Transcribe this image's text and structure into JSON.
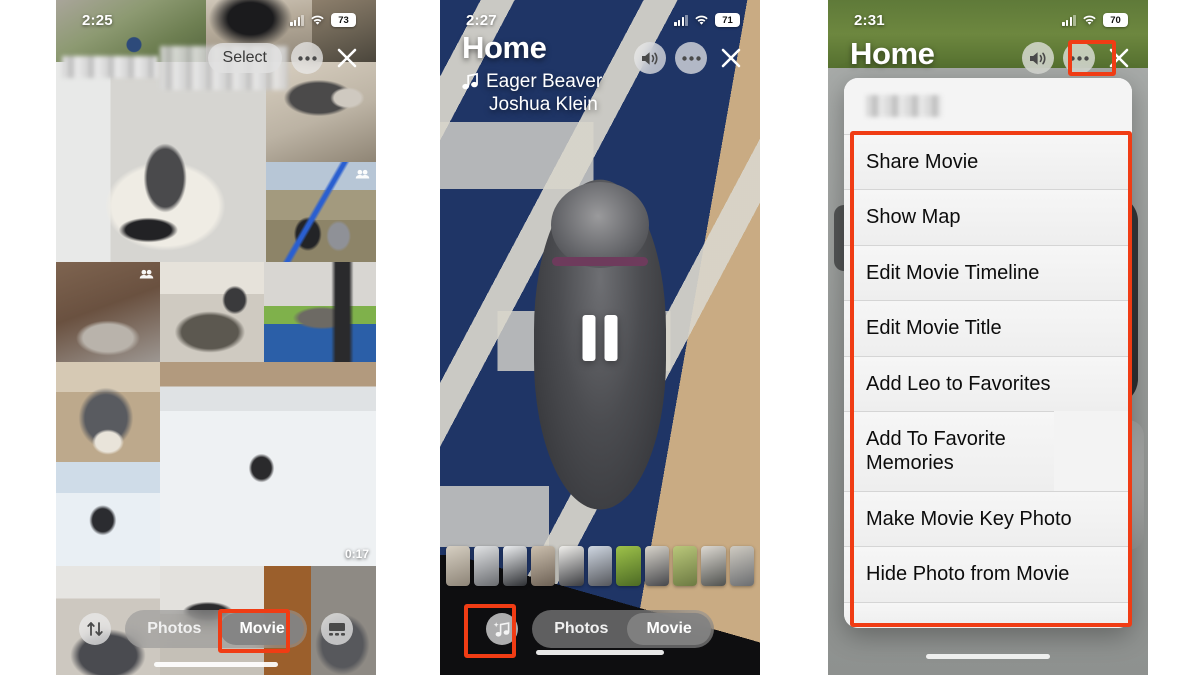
{
  "panels": {
    "left": {
      "status": {
        "time": "2:25",
        "battery": "73",
        "wifi_icon": "wifi-icon",
        "cellular_icon": "cellular-signal-icon"
      },
      "toolbar": {
        "select_label": "Select",
        "more_icon": "ellipsis-icon",
        "close_icon": "close-x-icon"
      },
      "grid": {
        "video_duration": "0:17",
        "people_badge_icon": "people-badge-icon",
        "redacted_label": ""
      },
      "bottom": {
        "sort_icon": "sort-arrows-icon",
        "segment": {
          "options": [
            "Photos",
            "Movie"
          ],
          "selected": "Movie"
        },
        "layout_icon": "grid-layout-icon"
      }
    },
    "middle": {
      "status": {
        "time": "2:27",
        "battery": "71",
        "wifi_icon": "wifi-icon",
        "cellular_icon": "cellular-signal-icon"
      },
      "title": "Home",
      "song": {
        "note_icon": "music-note-icon",
        "track": "Eager Beaver",
        "artist": "Joshua Klein"
      },
      "actions": {
        "volume_icon": "speaker-volume-icon",
        "more_icon": "ellipsis-icon",
        "close_icon": "close-x-icon"
      },
      "playback": {
        "state_icon": "pause-icon"
      },
      "bottom": {
        "music_icon": "music-note-sparkle-icon",
        "segment": {
          "options": [
            "Photos",
            "Movie"
          ],
          "selected": "Movie"
        }
      }
    },
    "right": {
      "status": {
        "time": "2:31",
        "battery": "70",
        "wifi_icon": "wifi-icon",
        "cellular_icon": "cellular-signal-icon"
      },
      "title": "Home",
      "actions": {
        "volume_icon": "speaker-volume-icon",
        "more_icon": "ellipsis-icon",
        "close_icon": "close-x-icon"
      },
      "menu": {
        "header_redacted": "",
        "items": [
          "Share Movie",
          "Show Map",
          "Edit Movie Timeline",
          "Edit Movie Title",
          "Add Leo to Favorites",
          "Add To Favorite Memories",
          "Make Movie Key Photo",
          "Hide Photo from Movie"
        ],
        "cut_off_item": ""
      }
    }
  },
  "highlight_color": "#F03C14"
}
